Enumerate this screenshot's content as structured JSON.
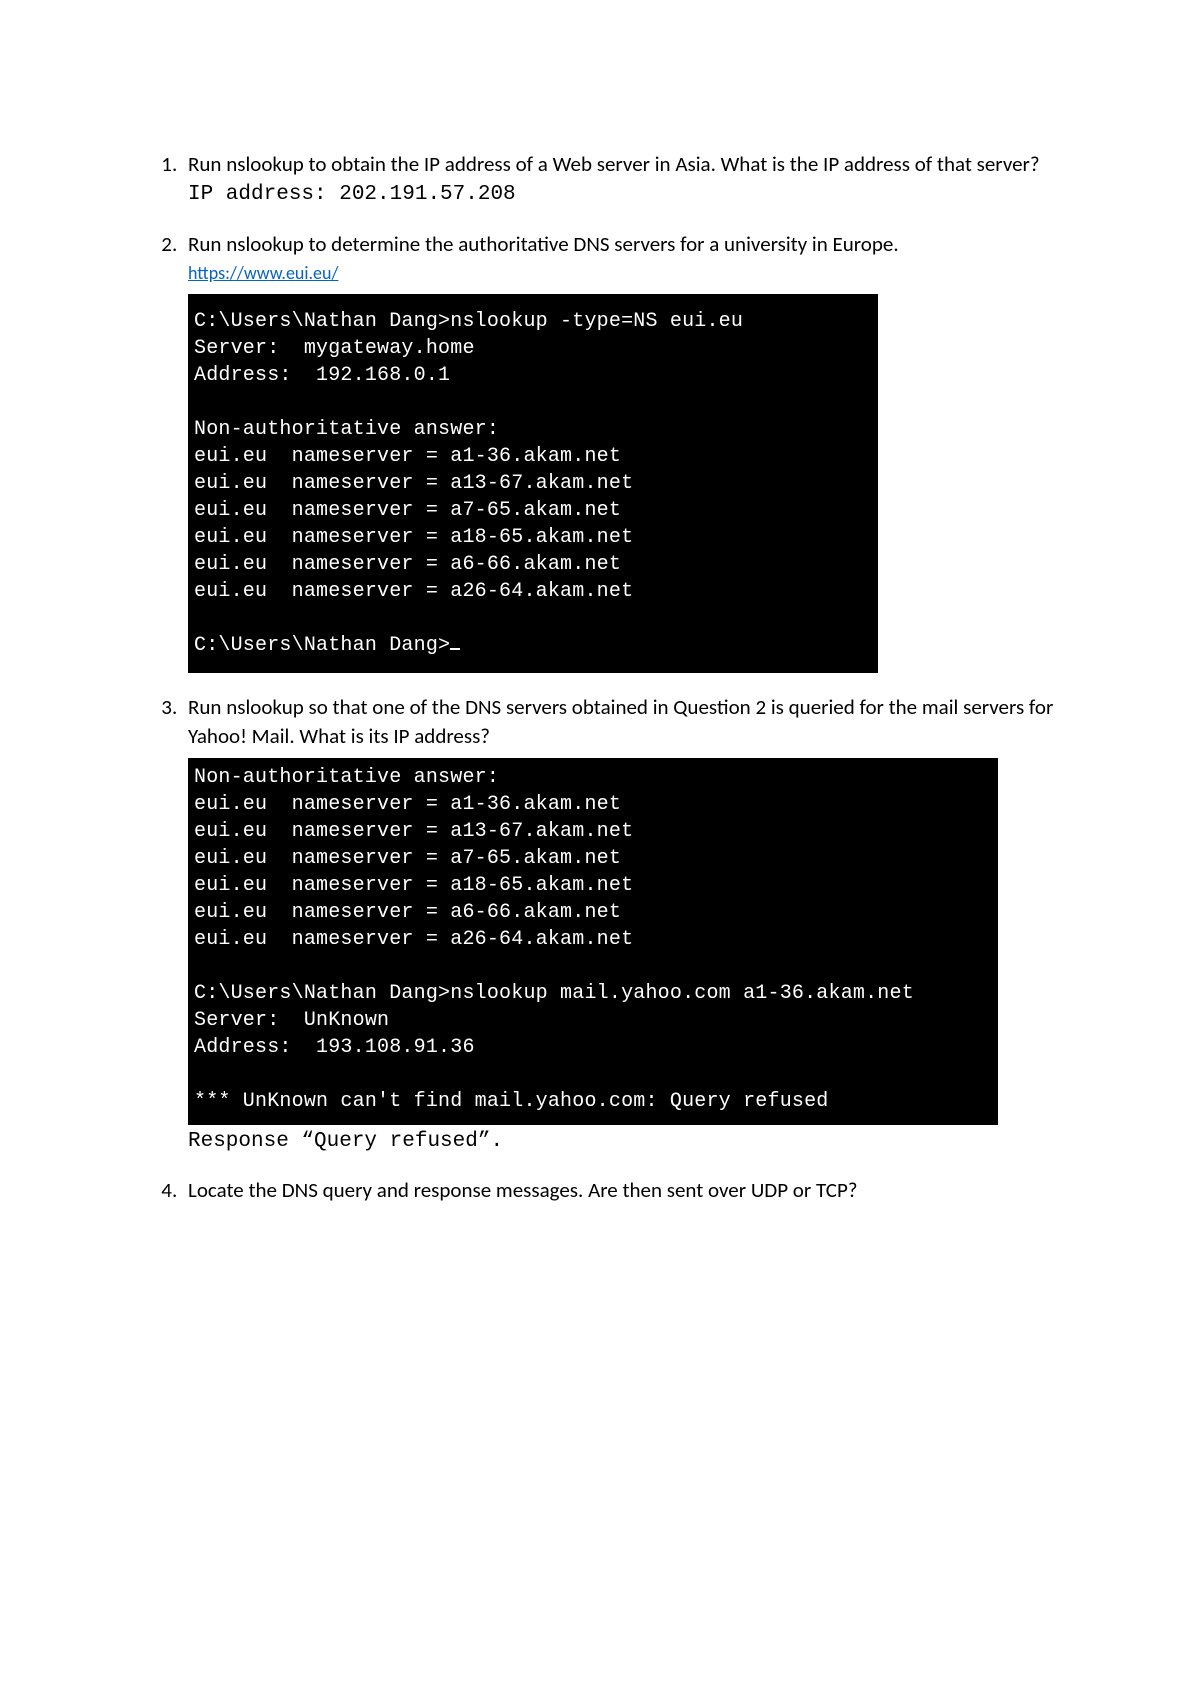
{
  "q1": {
    "text": "Run nslookup to obtain the IP address of a Web server in Asia. What is the IP address of that server?",
    "answer": "IP address: 202.191.57.208"
  },
  "q2": {
    "text": "Run nslookup to determine the authoritative DNS servers for a university in Europe.",
    "link": "https://www.eui.eu/",
    "terminal": "C:\\Users\\Nathan Dang>nslookup -type=NS eui.eu\nServer:  mygateway.home\nAddress:  192.168.0.1\n\nNon-authoritative answer:\neui.eu  nameserver = a1-36.akam.net\neui.eu  nameserver = a13-67.akam.net\neui.eu  nameserver = a7-65.akam.net\neui.eu  nameserver = a18-65.akam.net\neui.eu  nameserver = a6-66.akam.net\neui.eu  nameserver = a26-64.akam.net\n\nC:\\Users\\Nathan Dang>"
  },
  "q3": {
    "text": "Run nslookup so that one of the DNS servers obtained in Question 2 is queried for the mail servers for Yahoo! Mail. What is its IP address?",
    "terminal": "Non-authoritative answer:\neui.eu  nameserver = a1-36.akam.net\neui.eu  nameserver = a13-67.akam.net\neui.eu  nameserver = a7-65.akam.net\neui.eu  nameserver = a18-65.akam.net\neui.eu  nameserver = a6-66.akam.net\neui.eu  nameserver = a26-64.akam.net\n\nC:\\Users\\Nathan Dang>nslookup mail.yahoo.com a1-36.akam.net\nServer:  UnKnown\nAddress:  193.108.91.36\n\n*** UnKnown can't find mail.yahoo.com: Query refused",
    "response": "Response “Query refused”."
  },
  "q4": {
    "text": "Locate the DNS query and response messages. Are then sent over UDP or TCP?"
  }
}
